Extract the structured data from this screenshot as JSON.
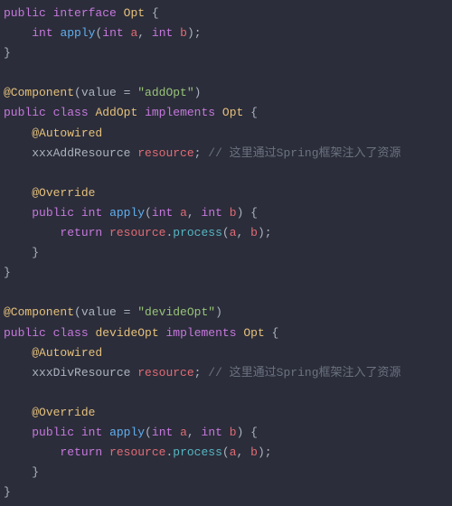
{
  "code": {
    "l1": {
      "kw_public": "public",
      "kw_interface": "interface",
      "type": "Opt",
      "brace": " {"
    },
    "l2": {
      "indent": "    ",
      "kw_int": "int",
      "fn": "apply",
      "p1": "(",
      "kw_int2": "int",
      "a": "a",
      "c": ", ",
      "kw_int3": "int",
      "b": "b",
      "p2": ");"
    },
    "l3": {
      "brace": "}"
    },
    "l5": {
      "ann": "@Component",
      "p1": "(",
      "param": "value",
      "eq": " = ",
      "str": "\"addOpt\"",
      "p2": ")"
    },
    "l6": {
      "kw_public": "public",
      "kw_class": "class",
      "type": "AddOpt",
      "kw_impl": "implements",
      "type2": "Opt",
      "brace": " {"
    },
    "l7": {
      "indent": "    ",
      "ann": "@Autowired"
    },
    "l8": {
      "indent": "    ",
      "type": "xxxAddResource",
      "field": "resource",
      "semi": "; ",
      "comment": "// 这里通过Spring框架注入了资源"
    },
    "l10": {
      "indent": "    ",
      "ann": "@Override"
    },
    "l11": {
      "indent": "    ",
      "kw_public": "public",
      "kw_int": "int",
      "fn": "apply",
      "p1": "(",
      "kw_int2": "int",
      "a": "a",
      "c": ", ",
      "kw_int3": "int",
      "b": "b",
      "p2": ") {"
    },
    "l12": {
      "indent": "        ",
      "kw_return": "return",
      "field": "resource",
      "dot": ".",
      "call": "process",
      "p1": "(",
      "a": "a",
      "c": ", ",
      "b": "b",
      "p2": ");"
    },
    "l13": {
      "indent": "    ",
      "brace": "}"
    },
    "l14": {
      "brace": "}"
    },
    "l16": {
      "ann": "@Component",
      "p1": "(",
      "param": "value",
      "eq": " = ",
      "str": "\"devideOpt\"",
      "p2": ")"
    },
    "l17": {
      "kw_public": "public",
      "kw_class": "class",
      "type": "devideOpt",
      "kw_impl": "implements",
      "type2": "Opt",
      "brace": " {"
    },
    "l18": {
      "indent": "    ",
      "ann": "@Autowired"
    },
    "l19": {
      "indent": "    ",
      "type": "xxxDivResource",
      "field": "resource",
      "semi": "; ",
      "comment": "// 这里通过Spring框架注入了资源"
    },
    "l21": {
      "indent": "    ",
      "ann": "@Override"
    },
    "l22": {
      "indent": "    ",
      "kw_public": "public",
      "kw_int": "int",
      "fn": "apply",
      "p1": "(",
      "kw_int2": "int",
      "a": "a",
      "c": ", ",
      "kw_int3": "int",
      "b": "b",
      "p2": ") {"
    },
    "l23": {
      "indent": "        ",
      "kw_return": "return",
      "field": "resource",
      "dot": ".",
      "call": "process",
      "p1": "(",
      "a": "a",
      "c": ", ",
      "b": "b",
      "p2": ");"
    },
    "l24": {
      "indent": "    ",
      "brace": "}"
    },
    "l25": {
      "brace": "}"
    }
  }
}
